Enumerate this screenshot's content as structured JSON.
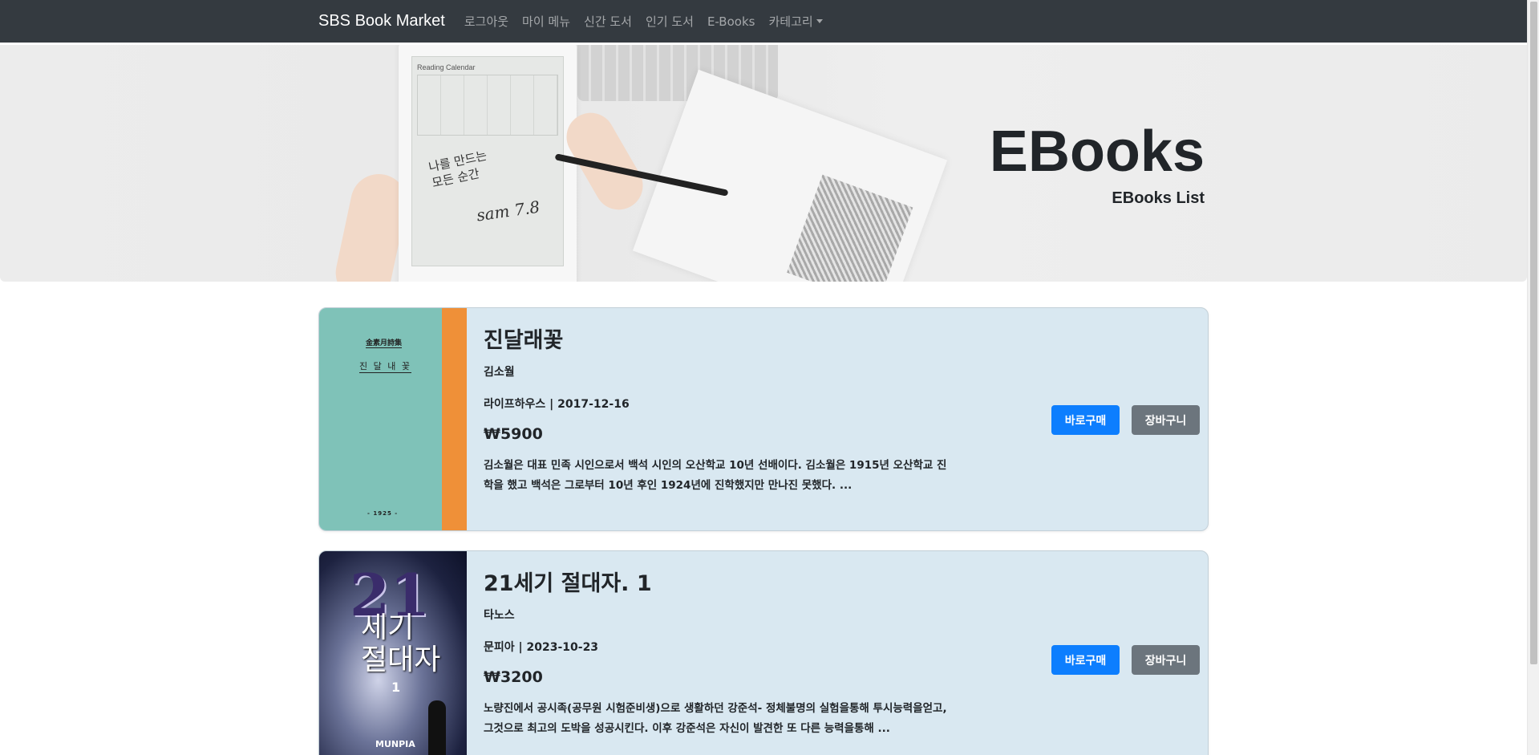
{
  "navbar": {
    "brand": "SBS Book Market",
    "links": [
      "로그아웃",
      "마이 메뉴",
      "신간 도서",
      "인기 도서",
      "E-Books",
      "카테고리"
    ]
  },
  "hero": {
    "title": "EBooks",
    "subtitle": "EBooks List",
    "image": {
      "calendar_label": "Reading Calendar",
      "handwriting_line1": "나를 만드는",
      "handwriting_line2": "모든 순간",
      "handwriting_sign": "sam 7.8"
    }
  },
  "books": [
    {
      "title": "진달래꽃",
      "author": "김소월",
      "publisher_date": "라이프하우스 | 2017-12-16",
      "price": "₩5900",
      "description": "김소월은 대표 민족 시인으로서 백석 시인의 오산학교 10년 선배이다. 김소월은 1915년 오산학교 진학을 했고 백석은 그로부터 10년 후인 1924년에 진학했지만 만나진 못했다. ...",
      "cover": {
        "line1": "金素月詩集",
        "line2": "진 달 내 꽃",
        "line3": "- 1925 -"
      },
      "buy_label": "바로구매",
      "cart_label": "장바구니"
    },
    {
      "title": "21세기 절대자. 1",
      "author": "타노스",
      "publisher_date": "문피아 | 2023-10-23",
      "price": "₩3200",
      "description": "노량진에서 공시족(공무원 시험준비생)으로 생활하던 강준석- 정체불명의 실험을통해 투시능력을얻고, 그것으로 최고의 도박을 성공시킨다. 이후 강준석은 자신이 발견한 또 다른 능력을통해 ...",
      "cover": {
        "big": "21",
        "sub1": "세기",
        "sub2": "절대자",
        "num": "1",
        "logo": "MUNPIA"
      },
      "buy_label": "바로구매",
      "cart_label": "장바구니"
    }
  ],
  "colors": {
    "navbar_bg": "#343a40",
    "card_bg": "#d9e8f1",
    "buy_button": "#0d7efe",
    "cart_button": "#6c757d"
  }
}
